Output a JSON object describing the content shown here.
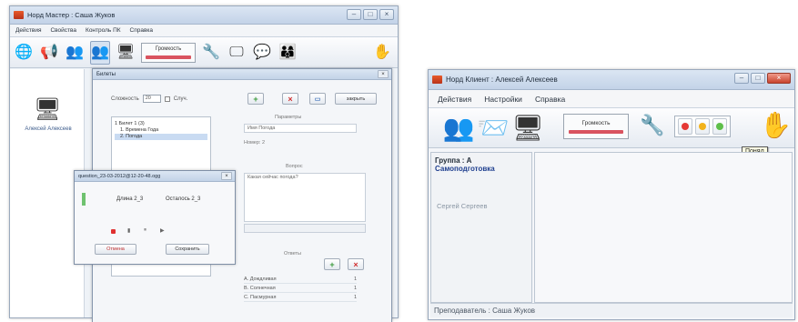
{
  "master": {
    "title": "Норд Мастер : Саша Жуков",
    "menu": [
      "Действия",
      "Свойства",
      "Контроль ПК",
      "Справка"
    ],
    "volume_label": "Громкость",
    "student": {
      "name": "Алексей Алексеев"
    },
    "tickets": {
      "title": "Билеты",
      "complexity_label": "Сложность",
      "complexity_value": "20",
      "random_label": "Случ.",
      "tree": [
        "1 Билет 1  (3)",
        "1. Времена Года",
        "2. Погода"
      ],
      "params_label": "Параметры",
      "param_value": "Имя Погода",
      "number_label": "Номер: 2",
      "question_label": "Вопрос",
      "question_text": "Какая сейчас погода?",
      "answers_label": "Ответы",
      "answers": [
        {
          "text": "A. Дождливая",
          "mark": "1"
        },
        {
          "text": "B. Солнечная",
          "mark": "1"
        },
        {
          "text": "C. Пасмурная",
          "mark": "1"
        }
      ],
      "close_label": "закрыть"
    },
    "record": {
      "title": "question_23-03-2012@12-20-48.ogg",
      "length": "Длина 2_3",
      "remaining": "Осталось 2_3",
      "cancel": "Отмена",
      "save": "Сохранить"
    }
  },
  "client": {
    "title": "Норд Клиент : Алексей Алексеев",
    "menu": [
      "Действия",
      "Настройки",
      "Справка"
    ],
    "volume_label": "Громкость",
    "tooltip": "Понял",
    "group": "Группа : А",
    "mode": "Самоподготовка",
    "student": "Сергей Сергеев",
    "status": "Преподаватель : Саша Жуков"
  },
  "colors": {
    "volume_bar": "#d9535f",
    "light_red": "#e53935",
    "light_yellow": "#f2b21b",
    "light_green": "#5fbf4a",
    "selfstudy": "#1f3f8f"
  },
  "icons": {
    "master_toolbar": [
      "globe-icon",
      "megaphone-icon",
      "users-icon",
      "users-selected-icon",
      "monitor-icon",
      "volume-icon",
      "wrench-icon",
      "screen-icon",
      "chat-icon",
      "group-icon",
      "hand-icon"
    ],
    "client_toolbar": [
      "users-icon",
      "envelope-icon",
      "monitor-icon",
      "wrench-icon",
      "hand-icon"
    ]
  }
}
